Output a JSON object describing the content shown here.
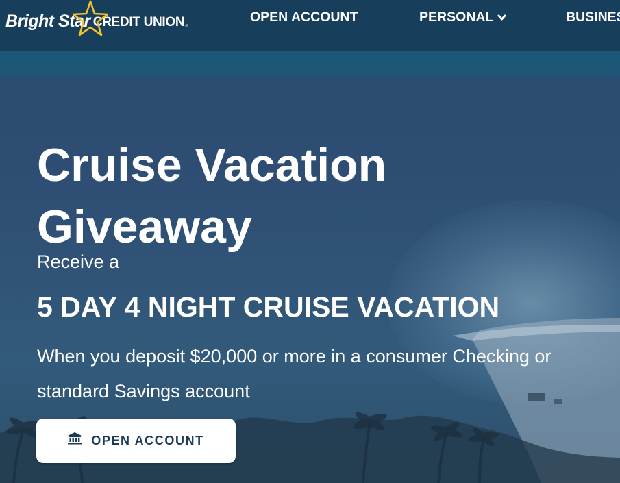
{
  "header": {
    "logo": {
      "name_italic": "Bright Star",
      "name_suffix": "CREDIT UNION",
      "registered": "®"
    },
    "nav": [
      {
        "label": "OPEN ACCOUNT"
      },
      {
        "label": "PERSONAL",
        "icon": "chevron-down-icon"
      },
      {
        "label": "BUSINESS"
      }
    ]
  },
  "hero": {
    "title_line1": "Cruise Vacation",
    "title_line2": "Giveaway",
    "intro": "Receive a",
    "headline": "5 DAY 4 NIGHT CRUISE VACATION",
    "description": "When you deposit $20,000 or more in a consumer Checking or standard Savings account",
    "cta": {
      "label": "OPEN ACCOUNT",
      "icon": "bank-icon"
    }
  },
  "colors": {
    "topbar": "#173f5b",
    "subbar": "#1c5778",
    "logo_star": "#f2c12e",
    "cta_text": "#1a3a56"
  }
}
